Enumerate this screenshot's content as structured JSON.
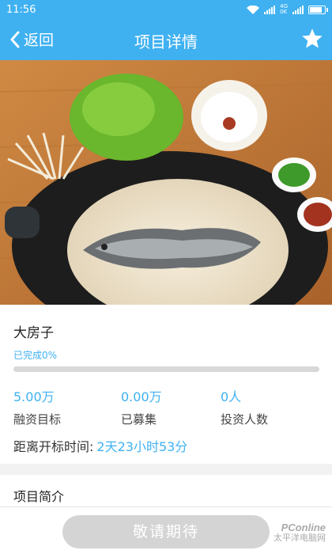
{
  "status": {
    "time": "11:56",
    "net_top": "4G",
    "net_bottom": "0K"
  },
  "nav": {
    "back_label": "返回",
    "title": "项目详情"
  },
  "project": {
    "name": "大房子",
    "progress_label": "已完成0%",
    "progress_fraction": 0.0,
    "stats": [
      {
        "value": "5.00万",
        "label": "融资目标"
      },
      {
        "value": "0.00万",
        "label": "已募集"
      },
      {
        "value": "0人",
        "label": "投资人数"
      }
    ],
    "deadline_label": "距离开标时间:",
    "deadline_value": "2天23小时53分"
  },
  "intro": {
    "title": "项目简介"
  },
  "cta": {
    "label": "敬请期待"
  },
  "watermark": {
    "line1": "PConline",
    "line2": "太平洋电脑网"
  },
  "colors": {
    "accent": "#3fb1f1",
    "disabled_button": "#d4d4d4"
  },
  "icons": {
    "back": "chevron-left-icon",
    "favorite": "star-icon",
    "hero": "fish-hotpot-photo"
  }
}
